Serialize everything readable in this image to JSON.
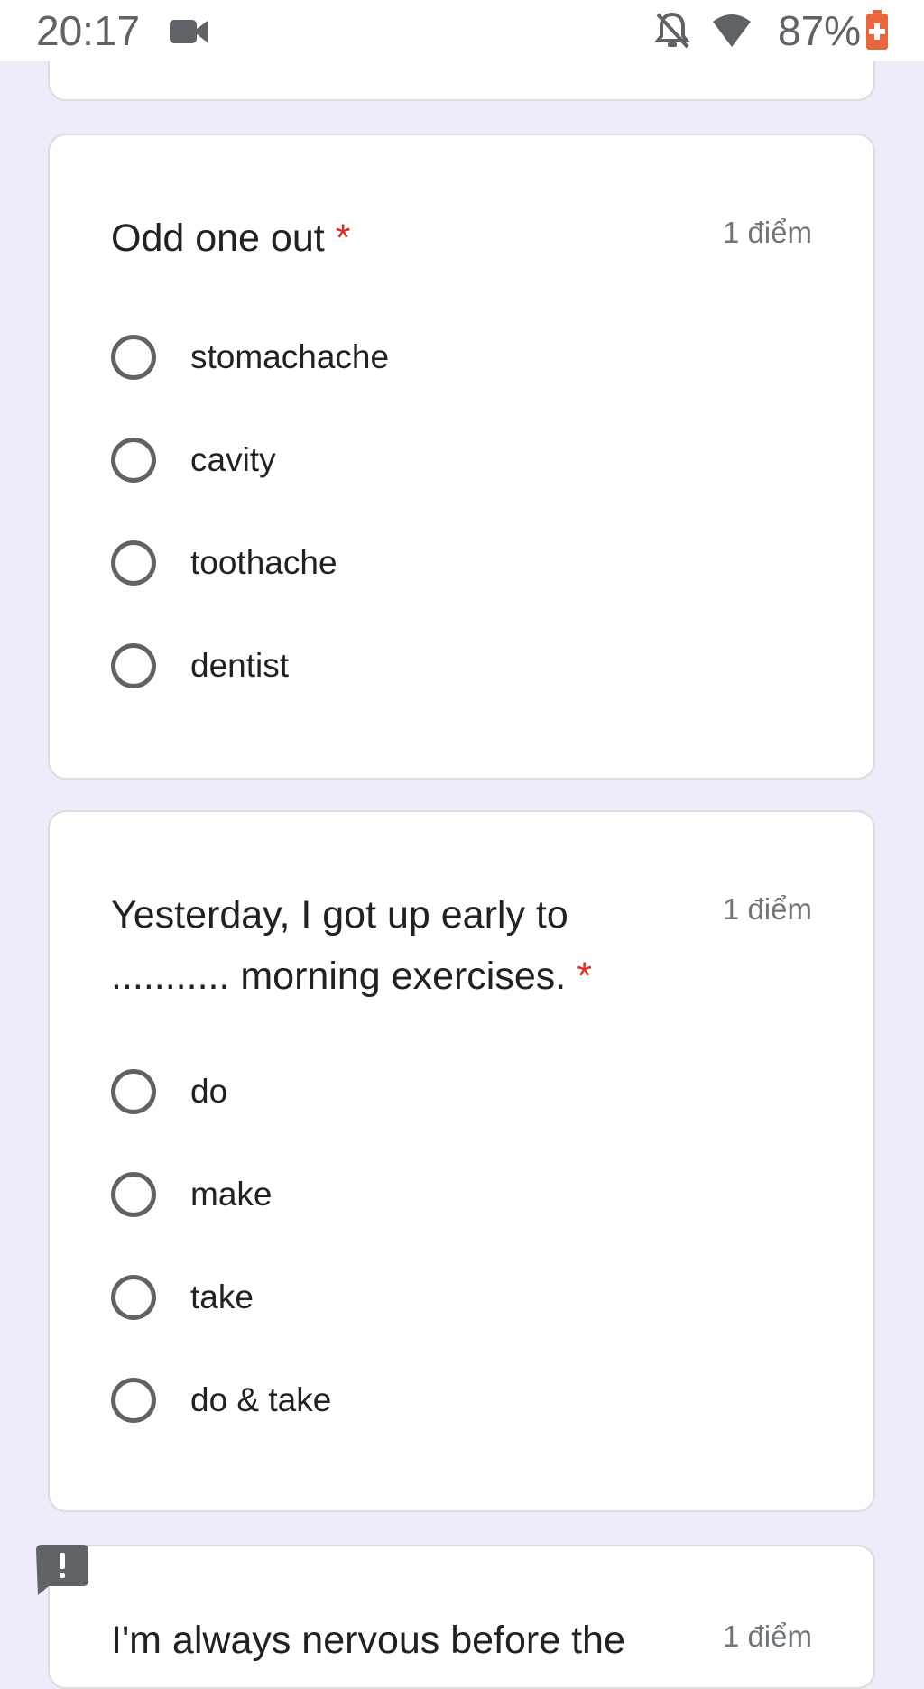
{
  "status_bar": {
    "time": "20:17",
    "icons": [
      "video-camera-icon",
      "notifications-off-icon",
      "wifi-icon",
      "battery-charging-icon"
    ],
    "battery_percent": "87%",
    "battery_color": "#e8663d"
  },
  "colors": {
    "background": "#efebf9",
    "card": "#ffffff",
    "required": "#d93025",
    "radio": "#5f6368"
  },
  "questions": [
    {
      "title": "Odd one out",
      "required_mark": "*",
      "points": "1 điểm",
      "options": [
        "stomachache",
        "cavity",
        "toothache",
        "dentist"
      ]
    },
    {
      "title_line1": "Yesterday, I got up early to",
      "title_line2": "........... morning exercises.",
      "required_mark": "*",
      "points": "1 điểm",
      "options": [
        "do",
        "make",
        "take",
        "do & take"
      ]
    },
    {
      "title": "I'm always nervous before the",
      "points": "1 điểm"
    }
  ],
  "feedback_button": {
    "icon": "report-feedback-icon"
  }
}
